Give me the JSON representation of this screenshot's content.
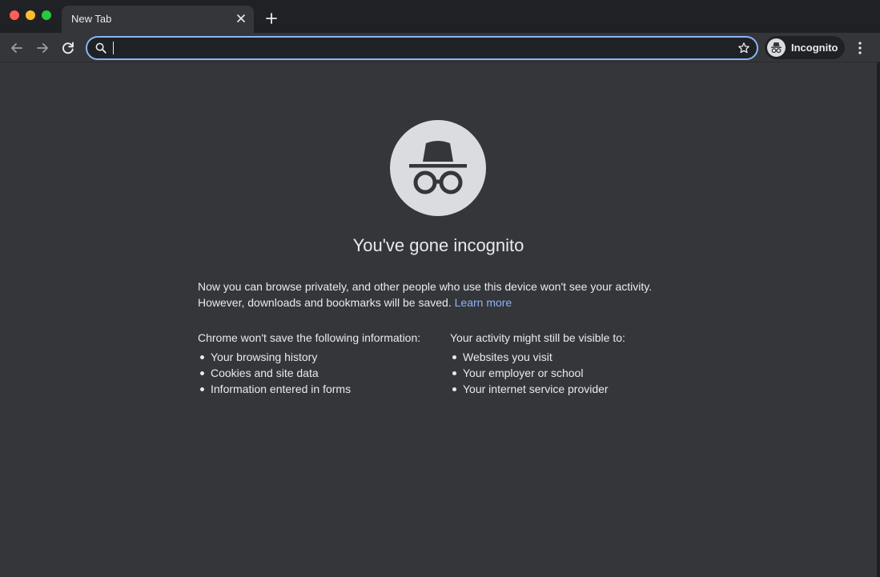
{
  "window": {
    "controls": [
      "close",
      "minimize",
      "maximize"
    ]
  },
  "tab": {
    "title": "New Tab",
    "close_icon": "close-icon"
  },
  "toolbar": {
    "back_icon": "arrow-left-icon",
    "forward_icon": "arrow-right-icon",
    "reload_icon": "reload-icon",
    "omnibox": {
      "value": "",
      "placeholder": "",
      "search_icon": "search-icon",
      "bookmark_icon": "star-icon"
    },
    "profile": {
      "label": "Incognito",
      "icon": "incognito-icon"
    },
    "menu_icon": "kebab-menu-icon"
  },
  "page": {
    "heading": "You've gone incognito",
    "intro": "Now you can browse privately, and other people who use this device won't see your activity. However, downloads and bookmarks will be saved.",
    "learn_more": "Learn more",
    "left_column": {
      "title": "Chrome won't save the following information:",
      "items": [
        "Your browsing history",
        "Cookies and site data",
        "Information entered in forms"
      ]
    },
    "right_column": {
      "title": "Your activity might still be visible to:",
      "items": [
        "Websites you visit",
        "Your employer or school",
        "Your internet service provider"
      ]
    }
  },
  "colors": {
    "accent": "#8ab4f8",
    "content_bg": "#35363a",
    "frame_bg": "#202124",
    "text": "#e8eaed"
  }
}
